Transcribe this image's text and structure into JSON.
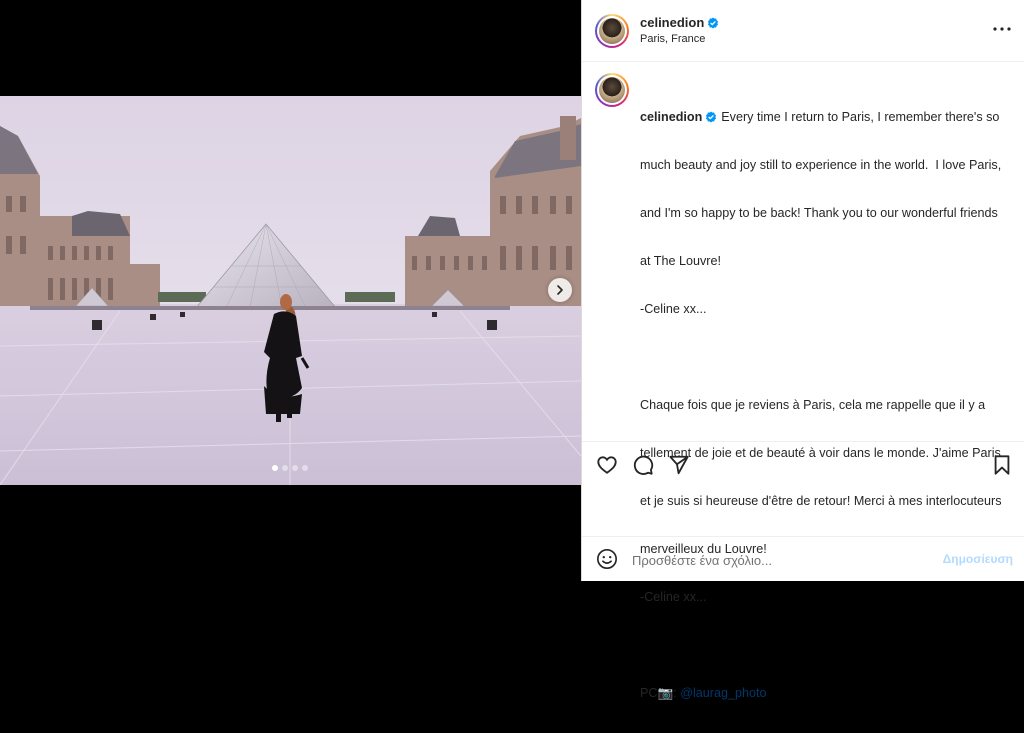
{
  "header": {
    "username": "celinedion",
    "location": "Paris, France",
    "verified": true
  },
  "caption": {
    "username": "celinedion",
    "paragraph1": [
      "Every time I return to Paris, I remember there's so",
      "much beauty and joy still to experience in the world.  I love Paris,",
      "and I'm so happy to be back! Thank you to our wonderful friends",
      "at The Louvre!",
      "-Celine xx..."
    ],
    "paragraph2": [
      "Chaque fois que je reviens à Paris, cela me rappelle que il y a",
      "tellement de joie et de beauté à voir dans le monde. J'aime Paris",
      "et je suis si heureuse d'être de retour! Merci à mes interlocuteurs",
      "merveilleux du Louvre!",
      "-Celine xx..."
    ],
    "credit_prefix": "PC📷: ",
    "credit_mention": "@laurag_photo"
  },
  "media": {
    "carousel_total": 4,
    "carousel_active": 1
  },
  "actions": {
    "like_icon": "heart-icon",
    "comment_icon": "comment-icon",
    "share_icon": "paper-plane-icon",
    "save_icon": "bookmark-icon"
  },
  "comment": {
    "placeholder": "Προσθέστε ένα σχόλιο...",
    "post_label": "Δημοσίευση"
  },
  "colors": {
    "verified_blue": "#0095f6",
    "mention_blue": "#00376b",
    "post_button_disabled": "#b3dbff"
  }
}
